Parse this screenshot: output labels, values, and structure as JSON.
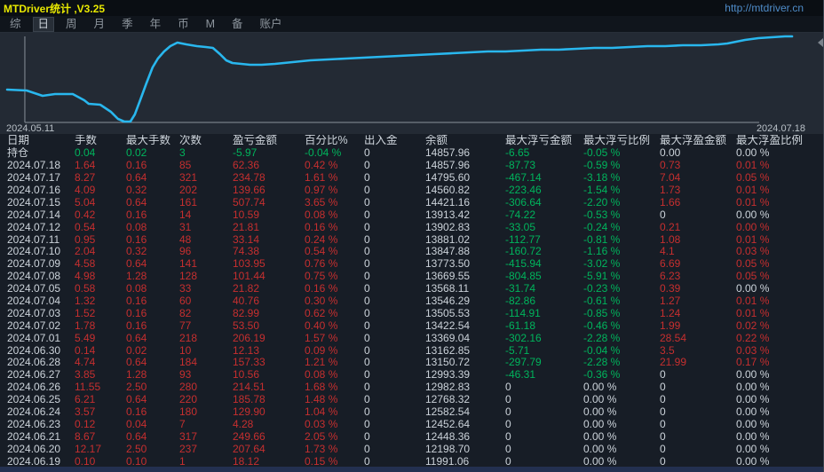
{
  "titlebar": {
    "title": "MTDriver统计 ,V3.25",
    "link": "http://mtdriver.cn"
  },
  "menubar": {
    "items": [
      {
        "label": "综",
        "active": false
      },
      {
        "label": "日",
        "active": true
      },
      {
        "label": "周",
        "active": false
      },
      {
        "label": "月",
        "active": false
      },
      {
        "label": "季",
        "active": false
      },
      {
        "label": "年",
        "active": false
      },
      {
        "label": "币",
        "active": false
      },
      {
        "label": "M",
        "active": false
      },
      {
        "label": "备",
        "active": false
      },
      {
        "label": "账户",
        "active": false
      }
    ]
  },
  "chart_data": {
    "type": "line",
    "title": "账户余额曲线 (equity curve)",
    "x_start_label": "2024.05.11",
    "x_end_label": "2024.07.18",
    "legend": "none",
    "grid": "off",
    "line_color": "#29b7ee",
    "axis_color": "#8a929a",
    "points": [
      [
        8,
        64
      ],
      [
        30,
        65
      ],
      [
        48,
        71
      ],
      [
        62,
        69
      ],
      [
        82,
        69
      ],
      [
        95,
        76
      ],
      [
        100,
        80
      ],
      [
        113,
        81
      ],
      [
        125,
        89
      ],
      [
        133,
        97
      ],
      [
        140,
        100
      ],
      [
        147,
        100
      ],
      [
        152,
        92
      ],
      [
        158,
        76
      ],
      [
        165,
        57
      ],
      [
        172,
        39
      ],
      [
        178,
        29
      ],
      [
        185,
        21
      ],
      [
        192,
        15
      ],
      [
        200,
        11
      ],
      [
        210,
        13
      ],
      [
        222,
        15
      ],
      [
        232,
        16
      ],
      [
        240,
        17
      ],
      [
        248,
        24
      ],
      [
        255,
        31
      ],
      [
        262,
        34
      ],
      [
        272,
        35
      ],
      [
        282,
        36
      ],
      [
        295,
        36
      ],
      [
        310,
        35
      ],
      [
        330,
        33
      ],
      [
        350,
        31
      ],
      [
        370,
        30
      ],
      [
        390,
        29
      ],
      [
        410,
        28
      ],
      [
        430,
        27
      ],
      [
        450,
        26
      ],
      [
        470,
        25
      ],
      [
        490,
        24
      ],
      [
        510,
        23
      ],
      [
        530,
        22
      ],
      [
        550,
        21
      ],
      [
        570,
        21
      ],
      [
        590,
        20
      ],
      [
        610,
        19
      ],
      [
        630,
        19
      ],
      [
        650,
        18
      ],
      [
        670,
        17
      ],
      [
        690,
        17
      ],
      [
        710,
        16
      ],
      [
        730,
        15
      ],
      [
        750,
        15
      ],
      [
        770,
        14
      ],
      [
        790,
        14
      ],
      [
        810,
        13
      ],
      [
        820,
        12
      ],
      [
        830,
        10
      ],
      [
        840,
        8
      ],
      [
        855,
        6
      ],
      [
        870,
        5
      ],
      [
        885,
        4
      ],
      [
        893,
        4
      ]
    ]
  },
  "table": {
    "headers": [
      "日期",
      "手数",
      "最大手数",
      "次数",
      "盈亏金额",
      "百分比%",
      "出入金",
      "余额",
      "最大浮亏金额",
      "最大浮亏比例",
      "最大浮盈金额",
      "最大浮盈比例"
    ],
    "rows": [
      {
        "cells": [
          "持仓",
          "0.04",
          "0.02",
          "3",
          "-5.97",
          "-0.04 %",
          "0",
          "14857.96",
          "-6.65",
          "-0.05 %",
          "0.00",
          "0.00 %"
        ],
        "colors": [
          "w",
          "g",
          "g",
          "g",
          "g",
          "g",
          "w",
          "w",
          "g",
          "g",
          "w",
          "w"
        ]
      },
      {
        "cells": [
          "2024.07.18",
          "1.64",
          "0.16",
          "85",
          "62.36",
          "0.42 %",
          "0",
          "14857.96",
          "-87.73",
          "-0.59 %",
          "0.73",
          "0.01 %"
        ],
        "colors": [
          "w",
          "r",
          "r",
          "r",
          "r",
          "r",
          "w",
          "w",
          "g",
          "g",
          "r",
          "r"
        ]
      },
      {
        "cells": [
          "2024.07.17",
          "8.27",
          "0.64",
          "321",
          "234.78",
          "1.61 %",
          "0",
          "14795.60",
          "-467.14",
          "-3.18 %",
          "7.04",
          "0.05 %"
        ],
        "colors": [
          "w",
          "r",
          "r",
          "r",
          "r",
          "r",
          "w",
          "w",
          "g",
          "g",
          "r",
          "r"
        ]
      },
      {
        "cells": [
          "2024.07.16",
          "4.09",
          "0.32",
          "202",
          "139.66",
          "0.97 %",
          "0",
          "14560.82",
          "-223.46",
          "-1.54 %",
          "1.73",
          "0.01 %"
        ],
        "colors": [
          "w",
          "r",
          "r",
          "r",
          "r",
          "r",
          "w",
          "w",
          "g",
          "g",
          "r",
          "r"
        ]
      },
      {
        "cells": [
          "2024.07.15",
          "5.04",
          "0.64",
          "161",
          "507.74",
          "3.65 %",
          "0",
          "14421.16",
          "-306.64",
          "-2.20 %",
          "1.66",
          "0.01 %"
        ],
        "colors": [
          "w",
          "r",
          "r",
          "r",
          "r",
          "r",
          "w",
          "w",
          "g",
          "g",
          "r",
          "r"
        ]
      },
      {
        "cells": [
          "2024.07.14",
          "0.42",
          "0.16",
          "14",
          "10.59",
          "0.08 %",
          "0",
          "13913.42",
          "-74.22",
          "-0.53 %",
          "0",
          "0.00 %"
        ],
        "colors": [
          "w",
          "r",
          "r",
          "r",
          "r",
          "r",
          "w",
          "w",
          "g",
          "g",
          "w",
          "w"
        ]
      },
      {
        "cells": [
          "2024.07.12",
          "0.54",
          "0.08",
          "31",
          "21.81",
          "0.16 %",
          "0",
          "13902.83",
          "-33.05",
          "-0.24 %",
          "0.21",
          "0.00 %"
        ],
        "colors": [
          "w",
          "r",
          "r",
          "r",
          "r",
          "r",
          "w",
          "w",
          "g",
          "g",
          "r",
          "r"
        ]
      },
      {
        "cells": [
          "2024.07.11",
          "0.95",
          "0.16",
          "48",
          "33.14",
          "0.24 %",
          "0",
          "13881.02",
          "-112.77",
          "-0.81 %",
          "1.08",
          "0.01 %"
        ],
        "colors": [
          "w",
          "r",
          "r",
          "r",
          "r",
          "r",
          "w",
          "w",
          "g",
          "g",
          "r",
          "r"
        ]
      },
      {
        "cells": [
          "2024.07.10",
          "2.04",
          "0.32",
          "96",
          "74.38",
          "0.54 %",
          "0",
          "13847.88",
          "-160.72",
          "-1.16 %",
          "4.1",
          "0.03 %"
        ],
        "colors": [
          "w",
          "r",
          "r",
          "r",
          "r",
          "r",
          "w",
          "w",
          "g",
          "g",
          "r",
          "r"
        ]
      },
      {
        "cells": [
          "2024.07.09",
          "4.58",
          "0.64",
          "141",
          "103.95",
          "0.76 %",
          "0",
          "13773.50",
          "-415.94",
          "-3.02 %",
          "6.69",
          "0.05 %"
        ],
        "colors": [
          "w",
          "r",
          "r",
          "r",
          "r",
          "r",
          "w",
          "w",
          "g",
          "g",
          "r",
          "r"
        ]
      },
      {
        "cells": [
          "2024.07.08",
          "4.98",
          "1.28",
          "128",
          "101.44",
          "0.75 %",
          "0",
          "13669.55",
          "-804.85",
          "-5.91 %",
          "6.23",
          "0.05 %"
        ],
        "colors": [
          "w",
          "r",
          "r",
          "r",
          "r",
          "r",
          "w",
          "w",
          "g",
          "g",
          "r",
          "r"
        ]
      },
      {
        "cells": [
          "2024.07.05",
          "0.58",
          "0.08",
          "33",
          "21.82",
          "0.16 %",
          "0",
          "13568.11",
          "-31.74",
          "-0.23 %",
          "0.39",
          "0.00 %"
        ],
        "colors": [
          "w",
          "r",
          "r",
          "r",
          "r",
          "r",
          "w",
          "w",
          "g",
          "g",
          "r",
          "w"
        ]
      },
      {
        "cells": [
          "2024.07.04",
          "1.32",
          "0.16",
          "60",
          "40.76",
          "0.30 %",
          "0",
          "13546.29",
          "-82.86",
          "-0.61 %",
          "1.27",
          "0.01 %"
        ],
        "colors": [
          "w",
          "r",
          "r",
          "r",
          "r",
          "r",
          "w",
          "w",
          "g",
          "g",
          "r",
          "r"
        ]
      },
      {
        "cells": [
          "2024.07.03",
          "1.52",
          "0.16",
          "82",
          "82.99",
          "0.62 %",
          "0",
          "13505.53",
          "-114.91",
          "-0.85 %",
          "1.24",
          "0.01 %"
        ],
        "colors": [
          "w",
          "r",
          "r",
          "r",
          "r",
          "r",
          "w",
          "w",
          "g",
          "g",
          "r",
          "r"
        ]
      },
      {
        "cells": [
          "2024.07.02",
          "1.78",
          "0.16",
          "77",
          "53.50",
          "0.40 %",
          "0",
          "13422.54",
          "-61.18",
          "-0.46 %",
          "1.99",
          "0.02 %"
        ],
        "colors": [
          "w",
          "r",
          "r",
          "r",
          "r",
          "r",
          "w",
          "w",
          "g",
          "g",
          "r",
          "r"
        ]
      },
      {
        "cells": [
          "2024.07.01",
          "5.49",
          "0.64",
          "218",
          "206.19",
          "1.57 %",
          "0",
          "13369.04",
          "-302.16",
          "-2.28 %",
          "28.54",
          "0.22 %"
        ],
        "colors": [
          "w",
          "r",
          "r",
          "r",
          "r",
          "r",
          "w",
          "w",
          "g",
          "g",
          "r",
          "r"
        ]
      },
      {
        "cells": [
          "2024.06.30",
          "0.14",
          "0.02",
          "10",
          "12.13",
          "0.09 %",
          "0",
          "13162.85",
          "-5.71",
          "-0.04 %",
          "3.5",
          "0.03 %"
        ],
        "colors": [
          "w",
          "r",
          "r",
          "r",
          "r",
          "r",
          "w",
          "w",
          "g",
          "g",
          "r",
          "r"
        ]
      },
      {
        "cells": [
          "2024.06.28",
          "4.74",
          "0.64",
          "184",
          "157.33",
          "1.21 %",
          "0",
          "13150.72",
          "-297.79",
          "-2.28 %",
          "21.99",
          "0.17 %"
        ],
        "colors": [
          "w",
          "r",
          "r",
          "r",
          "r",
          "r",
          "w",
          "w",
          "g",
          "g",
          "r",
          "r"
        ]
      },
      {
        "cells": [
          "2024.06.27",
          "3.85",
          "1.28",
          "93",
          "10.56",
          "0.08 %",
          "0",
          "12993.39",
          "-46.31",
          "-0.36 %",
          "0",
          "0.00 %"
        ],
        "colors": [
          "w",
          "r",
          "r",
          "r",
          "r",
          "r",
          "w",
          "w",
          "g",
          "g",
          "w",
          "w"
        ]
      },
      {
        "cells": [
          "2024.06.26",
          "11.55",
          "2.50",
          "280",
          "214.51",
          "1.68 %",
          "0",
          "12982.83",
          "0",
          "0.00 %",
          "0",
          "0.00 %"
        ],
        "colors": [
          "w",
          "r",
          "r",
          "r",
          "r",
          "r",
          "w",
          "w",
          "w",
          "w",
          "w",
          "w"
        ]
      },
      {
        "cells": [
          "2024.06.25",
          "6.21",
          "0.64",
          "220",
          "185.78",
          "1.48 %",
          "0",
          "12768.32",
          "0",
          "0.00 %",
          "0",
          "0.00 %"
        ],
        "colors": [
          "w",
          "r",
          "r",
          "r",
          "r",
          "r",
          "w",
          "w",
          "w",
          "w",
          "w",
          "w"
        ]
      },
      {
        "cells": [
          "2024.06.24",
          "3.57",
          "0.16",
          "180",
          "129.90",
          "1.04 %",
          "0",
          "12582.54",
          "0",
          "0.00 %",
          "0",
          "0.00 %"
        ],
        "colors": [
          "w",
          "r",
          "r",
          "r",
          "r",
          "r",
          "w",
          "w",
          "w",
          "w",
          "w",
          "w"
        ]
      },
      {
        "cells": [
          "2024.06.23",
          "0.12",
          "0.04",
          "7",
          "4.28",
          "0.03 %",
          "0",
          "12452.64",
          "0",
          "0.00 %",
          "0",
          "0.00 %"
        ],
        "colors": [
          "w",
          "r",
          "r",
          "r",
          "r",
          "r",
          "w",
          "w",
          "w",
          "w",
          "w",
          "w"
        ]
      },
      {
        "cells": [
          "2024.06.21",
          "8.67",
          "0.64",
          "317",
          "249.66",
          "2.05 %",
          "0",
          "12448.36",
          "0",
          "0.00 %",
          "0",
          "0.00 %"
        ],
        "colors": [
          "w",
          "r",
          "r",
          "r",
          "r",
          "r",
          "w",
          "w",
          "w",
          "w",
          "w",
          "w"
        ]
      },
      {
        "cells": [
          "2024.06.20",
          "12.17",
          "2.50",
          "237",
          "207.64",
          "1.73 %",
          "0",
          "12198.70",
          "0",
          "0.00 %",
          "0",
          "0.00 %"
        ],
        "colors": [
          "w",
          "r",
          "r",
          "r",
          "r",
          "r",
          "w",
          "w",
          "w",
          "w",
          "w",
          "w"
        ]
      },
      {
        "cells": [
          "2024.06.19",
          "0.10",
          "0.10",
          "1",
          "18.12",
          "0.15 %",
          "0",
          "11991.06",
          "0",
          "0.00 %",
          "0",
          "0.00 %"
        ],
        "colors": [
          "w",
          "r",
          "r",
          "r",
          "r",
          "r",
          "w",
          "w",
          "w",
          "w",
          "w",
          "w"
        ]
      }
    ]
  },
  "colors": {
    "profit_red": "#c62f2f",
    "loss_green": "#00b45c",
    "neutral_text": "#ccd3da",
    "chart_line": "#29b7ee",
    "title_yellow": "#e8e800",
    "link_blue": "#4f8cc9"
  }
}
